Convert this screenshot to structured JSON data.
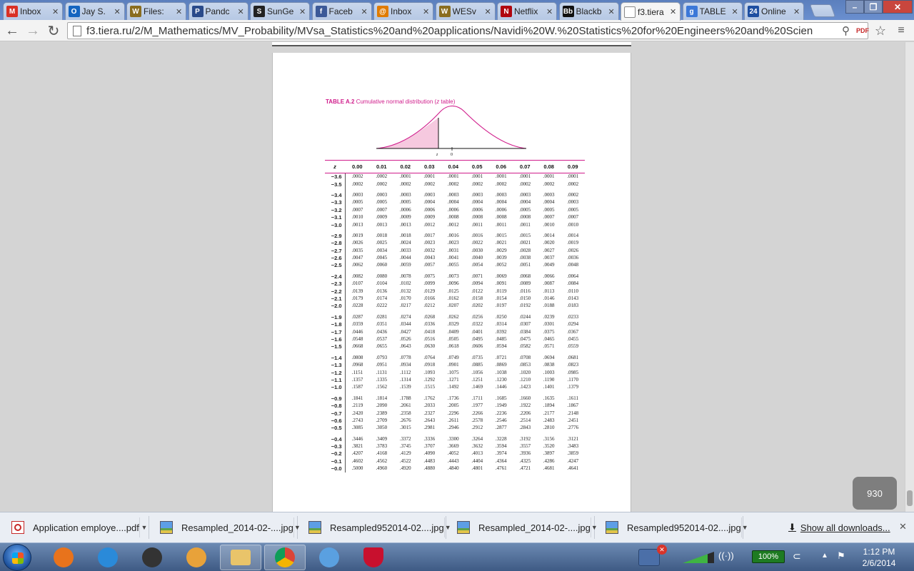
{
  "browser": {
    "tabs": [
      {
        "title": "Inbox",
        "icon": "gmail-icon",
        "color": "#d93025",
        "glyph": "M",
        "active": false
      },
      {
        "title": "Jay S.",
        "icon": "outlook-icon",
        "color": "#1565c0",
        "glyph": "O",
        "active": false
      },
      {
        "title": "Files:",
        "icon": "wyoming-icon",
        "color": "#8a6d1f",
        "glyph": "W",
        "active": false
      },
      {
        "title": "Pandc",
        "icon": "pandora-icon",
        "color": "#2a4a8a",
        "glyph": "P",
        "active": false
      },
      {
        "title": "SunGe",
        "icon": "sungard-icon",
        "color": "#222222",
        "glyph": "S",
        "active": false
      },
      {
        "title": "Faceb",
        "icon": "facebook-icon",
        "color": "#3b5998",
        "glyph": "f",
        "active": false
      },
      {
        "title": "Inbox",
        "icon": "mail-icon",
        "color": "#e07b00",
        "glyph": "@",
        "active": false
      },
      {
        "title": "WESv",
        "icon": "wyoming-icon",
        "color": "#8a6d1f",
        "glyph": "W",
        "active": false
      },
      {
        "title": "Netflix",
        "icon": "netflix-icon",
        "color": "#b0060f",
        "glyph": "N",
        "active": false
      },
      {
        "title": "Blackb",
        "icon": "blackboard-icon",
        "color": "#111111",
        "glyph": "Bb",
        "active": false
      },
      {
        "title": "f3.tiera",
        "icon": "page-icon",
        "color": "#ffffff",
        "glyph": "",
        "active": true
      },
      {
        "title": "TABLE",
        "icon": "google-icon",
        "color": "#3c78d8",
        "glyph": "g",
        "active": false
      },
      {
        "title": "Online",
        "icon": "online-icon",
        "color": "#1e4fa1",
        "glyph": "24",
        "active": false
      }
    ],
    "url": "f3.tiera.ru/2/M_Mathematics/MV_Probability/MVsa_Statistics%20and%20applications/Navidi%20W.%20Statistics%20for%20Engineers%20and%20Scien"
  },
  "document": {
    "table_label": "TABLE A.2",
    "table_caption_pre": "Cumulative normal distribution (",
    "table_caption_var": "z",
    "table_caption_post": " table)",
    "curve_label_z": "z",
    "curve_label_zero": "0",
    "z_header": "z",
    "column_headers": [
      "0.00",
      "0.01",
      "0.02",
      "0.03",
      "0.04",
      "0.05",
      "0.06",
      "0.07",
      "0.08",
      "0.09"
    ],
    "groups": [
      [
        {
          "z": "−3.6",
          "v": [
            ".0002",
            ".0002",
            ".0001",
            ".0001",
            ".0001",
            ".0001",
            ".0001",
            ".0001",
            ".0001",
            ".0001"
          ]
        },
        {
          "z": "−3.5",
          "v": [
            ".0002",
            ".0002",
            ".0002",
            ".0002",
            ".0002",
            ".0002",
            ".0002",
            ".0002",
            ".0002",
            ".0002"
          ]
        }
      ],
      [
        {
          "z": "−3.4",
          "v": [
            ".0003",
            ".0003",
            ".0003",
            ".0003",
            ".0003",
            ".0003",
            ".0003",
            ".0003",
            ".0003",
            ".0002"
          ]
        },
        {
          "z": "−3.3",
          "v": [
            ".0005",
            ".0005",
            ".0005",
            ".0004",
            ".0004",
            ".0004",
            ".0004",
            ".0004",
            ".0004",
            ".0003"
          ]
        },
        {
          "z": "−3.2",
          "v": [
            ".0007",
            ".0007",
            ".0006",
            ".0006",
            ".0006",
            ".0006",
            ".0006",
            ".0005",
            ".0005",
            ".0005"
          ]
        },
        {
          "z": "−3.1",
          "v": [
            ".0010",
            ".0009",
            ".0009",
            ".0009",
            ".0008",
            ".0008",
            ".0008",
            ".0008",
            ".0007",
            ".0007"
          ]
        },
        {
          "z": "−3.0",
          "v": [
            ".0013",
            ".0013",
            ".0013",
            ".0012",
            ".0012",
            ".0011",
            ".0011",
            ".0011",
            ".0010",
            ".0010"
          ]
        }
      ],
      [
        {
          "z": "−2.9",
          "v": [
            ".0019",
            ".0018",
            ".0018",
            ".0017",
            ".0016",
            ".0016",
            ".0015",
            ".0015",
            ".0014",
            ".0014"
          ]
        },
        {
          "z": "−2.8",
          "v": [
            ".0026",
            ".0025",
            ".0024",
            ".0023",
            ".0023",
            ".0022",
            ".0021",
            ".0021",
            ".0020",
            ".0019"
          ]
        },
        {
          "z": "−2.7",
          "v": [
            ".0035",
            ".0034",
            ".0033",
            ".0032",
            ".0031",
            ".0030",
            ".0029",
            ".0028",
            ".0027",
            ".0026"
          ]
        },
        {
          "z": "−2.6",
          "v": [
            ".0047",
            ".0045",
            ".0044",
            ".0043",
            ".0041",
            ".0040",
            ".0039",
            ".0038",
            ".0037",
            ".0036"
          ]
        },
        {
          "z": "−2.5",
          "v": [
            ".0062",
            ".0060",
            ".0059",
            ".0057",
            ".0055",
            ".0054",
            ".0052",
            ".0051",
            ".0049",
            ".0048"
          ]
        }
      ],
      [
        {
          "z": "−2.4",
          "v": [
            ".0082",
            ".0080",
            ".0078",
            ".0075",
            ".0073",
            ".0071",
            ".0069",
            ".0068",
            ".0066",
            ".0064"
          ]
        },
        {
          "z": "−2.3",
          "v": [
            ".0107",
            ".0104",
            ".0102",
            ".0099",
            ".0096",
            ".0094",
            ".0091",
            ".0089",
            ".0087",
            ".0084"
          ]
        },
        {
          "z": "−2.2",
          "v": [
            ".0139",
            ".0136",
            ".0132",
            ".0129",
            ".0125",
            ".0122",
            ".0119",
            ".0116",
            ".0113",
            ".0110"
          ]
        },
        {
          "z": "−2.1",
          "v": [
            ".0179",
            ".0174",
            ".0170",
            ".0166",
            ".0162",
            ".0158",
            ".0154",
            ".0150",
            ".0146",
            ".0143"
          ]
        },
        {
          "z": "−2.0",
          "v": [
            ".0228",
            ".0222",
            ".0217",
            ".0212",
            ".0207",
            ".0202",
            ".0197",
            ".0192",
            ".0188",
            ".0183"
          ]
        }
      ],
      [
        {
          "z": "−1.9",
          "v": [
            ".0287",
            ".0281",
            ".0274",
            ".0268",
            ".0262",
            ".0256",
            ".0250",
            ".0244",
            ".0239",
            ".0233"
          ]
        },
        {
          "z": "−1.8",
          "v": [
            ".0359",
            ".0351",
            ".0344",
            ".0336",
            ".0329",
            ".0322",
            ".0314",
            ".0307",
            ".0301",
            ".0294"
          ]
        },
        {
          "z": "−1.7",
          "v": [
            ".0446",
            ".0436",
            ".0427",
            ".0418",
            ".0409",
            ".0401",
            ".0392",
            ".0384",
            ".0375",
            ".0367"
          ]
        },
        {
          "z": "−1.6",
          "v": [
            ".0548",
            ".0537",
            ".0526",
            ".0516",
            ".0505",
            ".0495",
            ".0485",
            ".0475",
            ".0465",
            ".0455"
          ]
        },
        {
          "z": "−1.5",
          "v": [
            ".0668",
            ".0655",
            ".0643",
            ".0630",
            ".0618",
            ".0606",
            ".0594",
            ".0582",
            ".0571",
            ".0559"
          ]
        }
      ],
      [
        {
          "z": "−1.4",
          "v": [
            ".0808",
            ".0793",
            ".0778",
            ".0764",
            ".0749",
            ".0735",
            ".0721",
            ".0708",
            ".0694",
            ".0681"
          ]
        },
        {
          "z": "−1.3",
          "v": [
            ".0968",
            ".0951",
            ".0934",
            ".0918",
            ".0901",
            ".0885",
            ".0869",
            ".0853",
            ".0838",
            ".0823"
          ]
        },
        {
          "z": "−1.2",
          "v": [
            ".1151",
            ".1131",
            ".1112",
            ".1093",
            ".1075",
            ".1056",
            ".1038",
            ".1020",
            ".1003",
            ".0985"
          ]
        },
        {
          "z": "−1.1",
          "v": [
            ".1357",
            ".1335",
            ".1314",
            ".1292",
            ".1271",
            ".1251",
            ".1230",
            ".1210",
            ".1190",
            ".1170"
          ]
        },
        {
          "z": "−1.0",
          "v": [
            ".1587",
            ".1562",
            ".1539",
            ".1515",
            ".1492",
            ".1469",
            ".1446",
            ".1423",
            ".1401",
            ".1379"
          ]
        }
      ],
      [
        {
          "z": "−0.9",
          "v": [
            ".1841",
            ".1814",
            ".1788",
            ".1762",
            ".1736",
            ".1711",
            ".1685",
            ".1660",
            ".1635",
            ".1611"
          ]
        },
        {
          "z": "−0.8",
          "v": [
            ".2119",
            ".2090",
            ".2061",
            ".2033",
            ".2005",
            ".1977",
            ".1949",
            ".1922",
            ".1894",
            ".1867"
          ]
        },
        {
          "z": "−0.7",
          "v": [
            ".2420",
            ".2389",
            ".2358",
            ".2327",
            ".2296",
            ".2266",
            ".2236",
            ".2206",
            ".2177",
            ".2148"
          ]
        },
        {
          "z": "−0.6",
          "v": [
            ".2743",
            ".2709",
            ".2676",
            ".2643",
            ".2611",
            ".2578",
            ".2546",
            ".2514",
            ".2483",
            ".2451"
          ]
        },
        {
          "z": "−0.5",
          "v": [
            ".3085",
            ".3050",
            ".3015",
            ".2981",
            ".2946",
            ".2912",
            ".2877",
            ".2843",
            ".2810",
            ".2776"
          ]
        }
      ],
      [
        {
          "z": "−0.4",
          "v": [
            ".3446",
            ".3409",
            ".3372",
            ".3336",
            ".3300",
            ".3264",
            ".3228",
            ".3192",
            ".3156",
            ".3121"
          ]
        },
        {
          "z": "−0.3",
          "v": [
            ".3821",
            ".3783",
            ".3745",
            ".3707",
            ".3669",
            ".3632",
            ".3594",
            ".3557",
            ".3520",
            ".3483"
          ]
        },
        {
          "z": "−0.2",
          "v": [
            ".4207",
            ".4168",
            ".4129",
            ".4090",
            ".4052",
            ".4013",
            ".3974",
            ".3936",
            ".3897",
            ".3859"
          ]
        },
        {
          "z": "−0.1",
          "v": [
            ".4602",
            ".4562",
            ".4522",
            ".4483",
            ".4443",
            ".4404",
            ".4364",
            ".4325",
            ".4286",
            ".4247"
          ]
        },
        {
          "z": "−0.0",
          "v": [
            ".5000",
            ".4960",
            ".4920",
            ".4880",
            ".4840",
            ".4801",
            ".4761",
            ".4721",
            ".4681",
            ".4641"
          ]
        }
      ]
    ],
    "page_number": "930",
    "accent_color": "#d01c8b"
  },
  "downloads": {
    "items": [
      {
        "name": "Application employe....pdf",
        "icon": "pdf-icon"
      },
      {
        "name": "Resampled_2014-02-....jpg",
        "icon": "image-file-icon"
      },
      {
        "name": "Resampled952014-02....jpg",
        "icon": "image-file-icon"
      },
      {
        "name": "Resampled_2014-02-....jpg",
        "icon": "image-file-icon"
      },
      {
        "name": "Resampled952014-02....jpg",
        "icon": "image-file-icon"
      }
    ],
    "show_all": "Show all downloads..."
  },
  "taskbar": {
    "apps": [
      {
        "name": "firefox-icon",
        "color": "#e8731c"
      },
      {
        "name": "internet-explorer-icon",
        "color": "#2a8ad9"
      },
      {
        "name": "scanner-icon",
        "color": "#333333"
      },
      {
        "name": "media-player-icon",
        "color": "#e8a23a"
      },
      {
        "name": "file-explorer-icon",
        "color": "#e9c46a"
      },
      {
        "name": "chrome-icon",
        "color": "#db4437"
      },
      {
        "name": "itunes-icon",
        "color": "#5aa0e0"
      },
      {
        "name": "mcafee-icon",
        "color": "#c8102e"
      }
    ],
    "battery": "100%",
    "time": "1:12 PM",
    "date": "2/6/2014"
  }
}
